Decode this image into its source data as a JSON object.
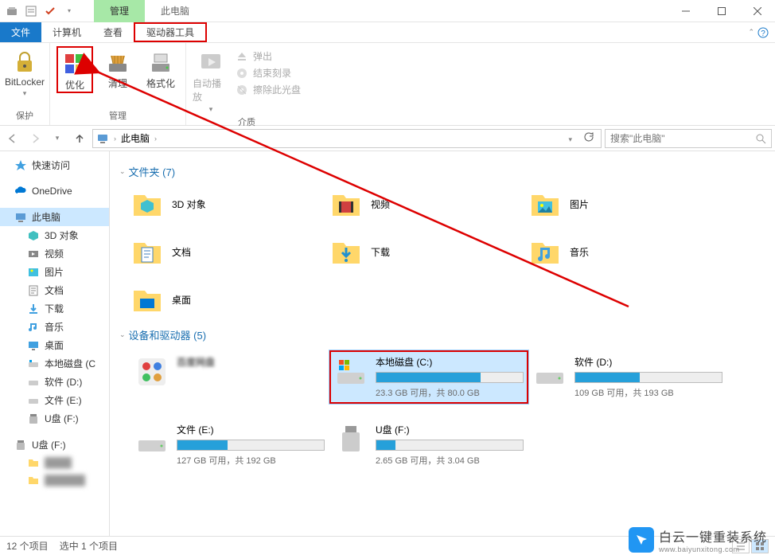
{
  "titlebar": {
    "tab_manage": "管理",
    "tab_thispc": "此电脑"
  },
  "menubar": {
    "file": "文件",
    "computer": "计算机",
    "view": "查看",
    "drive_tools": "驱动器工具"
  },
  "ribbon": {
    "bitlocker": "BitLocker",
    "optimize": "优化",
    "cleanup": "清理",
    "format": "格式化",
    "autoplay": "自动播放",
    "eject": "弹出",
    "finalize": "结束刻录",
    "erase": "擦除此光盘",
    "group_protect": "保护",
    "group_manage": "管理",
    "group_media": "介质"
  },
  "breadcrumb": {
    "thispc": "此电脑"
  },
  "search": {
    "placeholder": "搜索\"此电脑\""
  },
  "tree": {
    "quick_access": "快速访问",
    "onedrive": "OneDrive",
    "thispc": "此电脑",
    "objects3d": "3D 对象",
    "videos": "视频",
    "pictures": "图片",
    "documents": "文档",
    "downloads": "下载",
    "music": "音乐",
    "desktop": "桌面",
    "local_c": "本地磁盘 (C",
    "software_d": "软件 (D:)",
    "files_e": "文件 (E:)",
    "usb_f": "U盘 (F:)",
    "usb_f2": "U盘 (F:)"
  },
  "sections": {
    "folders": "文件夹 (7)",
    "devices": "设备和驱动器 (5)"
  },
  "folders": {
    "objects3d": "3D 对象",
    "videos": "视频",
    "pictures": "图片",
    "documents": "文档",
    "downloads": "下载",
    "music": "音乐",
    "desktop": "桌面"
  },
  "drives": {
    "netdisk_name": "百度网盘",
    "c_name": "本地磁盘 (C:)",
    "c_info": "23.3 GB 可用，共 80.0 GB",
    "d_name": "软件 (D:)",
    "d_info": "109 GB 可用，共 193 GB",
    "e_name": "文件 (E:)",
    "e_info": "127 GB 可用，共 192 GB",
    "f_name": "U盘 (F:)",
    "f_info": "2.65 GB 可用，共 3.04 GB"
  },
  "status": {
    "count": "12 个项目",
    "selected": "选中 1 个项目"
  },
  "watermark": {
    "line1": "白云一键重装系统",
    "line2": "www.baiyunxitong.com"
  }
}
